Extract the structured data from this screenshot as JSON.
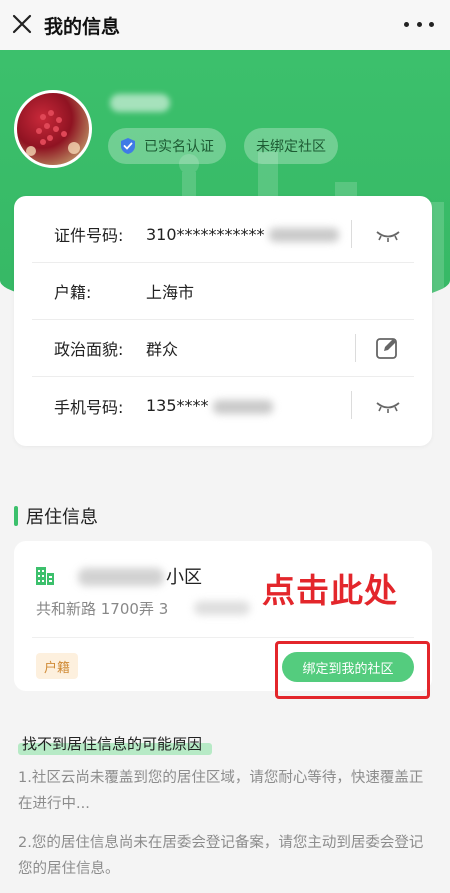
{
  "topbar": {
    "title": "我的信息"
  },
  "profile": {
    "badge_verified": "已实名认证",
    "badge_community": "未绑定社区"
  },
  "info_rows": [
    {
      "label": "证件号码:",
      "value": "310***********",
      "icon": "eye-closed-icon"
    },
    {
      "label": "户籍:",
      "value": "上海市",
      "icon": null
    },
    {
      "label": "政治面貌:",
      "value": "群众",
      "icon": "edit-icon"
    },
    {
      "label": "手机号码:",
      "value": "135****",
      "icon": "eye-closed-icon"
    }
  ],
  "residence": {
    "section_title": "居住信息",
    "name_suffix": "小区",
    "address": "共和新路 1700弄 3",
    "tag": "户籍",
    "bind_button": "绑定到我的社区"
  },
  "annotation": {
    "text": "点击此处",
    "color": "#e3262b"
  },
  "reasons": {
    "title": "找不到居住信息的可能原因",
    "item1": "1.社区云尚未覆盖到您的居住区域，请您耐心等待，快速覆盖正在进行中...",
    "item2": "2.您的居住信息尚未在居委会登记备案，请您主动到居委会登记您的居住信息。"
  },
  "colors": {
    "brand_green": "#3cc06c",
    "button_green": "#54cc7e",
    "tag_orange": "#d08b37"
  }
}
